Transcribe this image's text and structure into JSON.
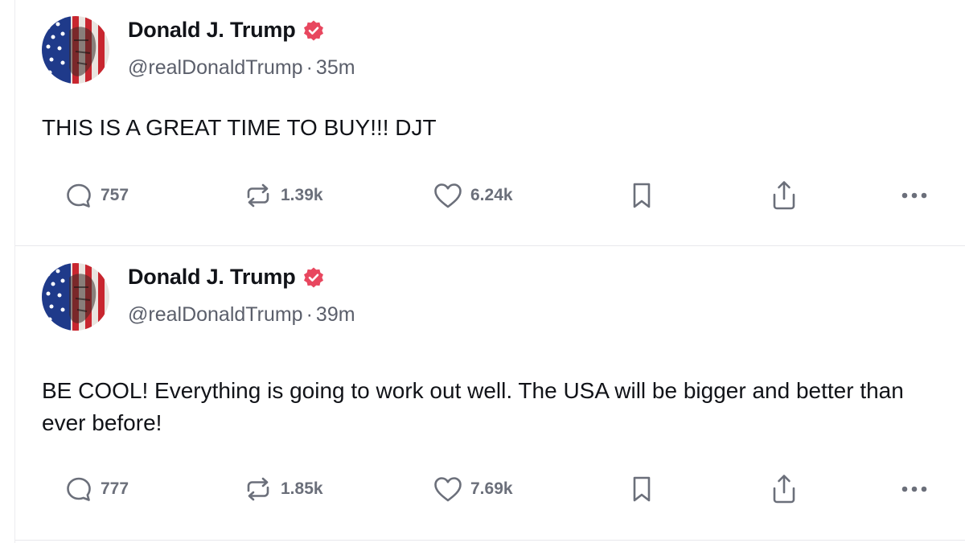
{
  "posts": [
    {
      "author_name": "Donald J. Trump",
      "handle": "@realDonaldTrump",
      "separator": "·",
      "time": "35m",
      "text": "THIS IS A GREAT TIME TO BUY!!! DJT",
      "replies": "757",
      "retruths": "1.39k",
      "likes": "6.24k",
      "verified": true
    },
    {
      "author_name": "Donald J. Trump",
      "handle": "@realDonaldTrump",
      "separator": "·",
      "time": "39m",
      "text": "BE COOL! Everything is going to work out well. The USA will be bigger and better than ever before!",
      "replies": "777",
      "retruths": "1.85k",
      "likes": "7.69k",
      "verified": true
    }
  ],
  "icons": {
    "reply": "reply-icon",
    "retruth": "retruth-icon",
    "like": "heart-icon",
    "bookmark": "bookmark-icon",
    "share": "share-icon",
    "more": "more-icon",
    "verified": "verified-badge-icon"
  },
  "colors": {
    "verified_badge": "#e8475f",
    "text_primary": "#111318",
    "text_secondary": "#5b5f6b",
    "action_gray": "#6b6f7a"
  }
}
